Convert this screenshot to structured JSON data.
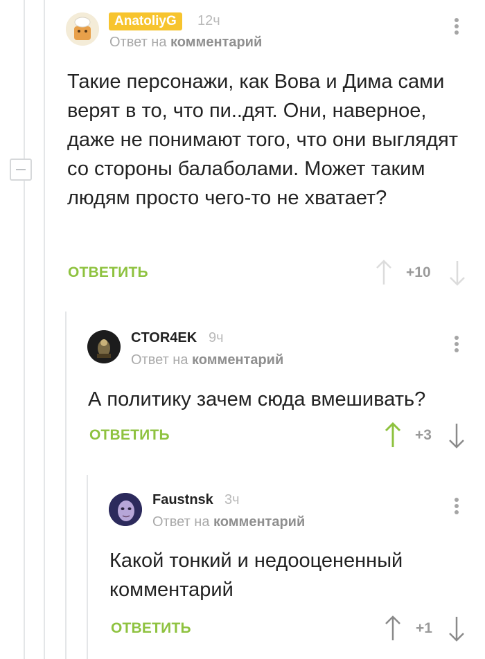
{
  "comments": [
    {
      "author": "AnatoliyG",
      "time": "12ч",
      "reply_prefix": "Ответ на",
      "reply_target": "комментарий",
      "text": "Такие персонажи, как Вова и Дима сами верят в то, что пи..дят. Они, наверное, даже не понимают того, что они выглядят со стороны балаболами. Может таким людям просто чего-то не хватает?",
      "reply_label": "ОТВЕТИТЬ",
      "score": "+10",
      "vote_state": "none"
    },
    {
      "author": "CTOR4EK",
      "time": "9ч",
      "reply_prefix": "Ответ на",
      "reply_target": "комментарий",
      "text": "А политику зачем сюда вмешивать?",
      "reply_label": "ОТВЕТИТЬ",
      "score": "+3",
      "vote_state": "upvoted"
    },
    {
      "author": "Faustnsk",
      "time": "3ч",
      "reply_prefix": "Ответ на",
      "reply_target": "комментарий",
      "text": "Какой тонкий и недооцененный комментарий",
      "reply_label": "ОТВЕТИТЬ",
      "score": "+1",
      "vote_state": "none"
    }
  ],
  "colors": {
    "accent_green": "#8ec23f",
    "badge_yellow": "#f7c42e",
    "muted_gray": "#a9a9a9",
    "thread_line": "#e4e6e8"
  }
}
